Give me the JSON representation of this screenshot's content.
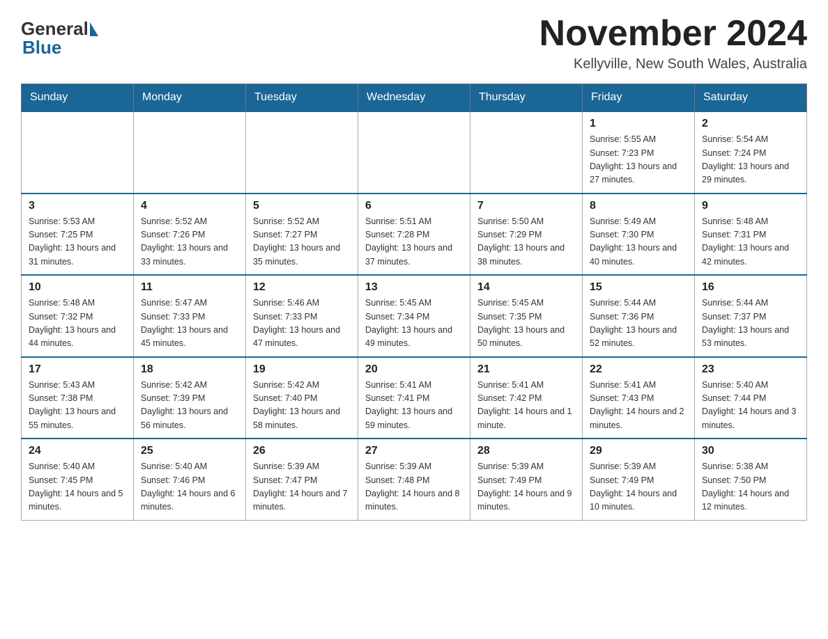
{
  "header": {
    "logo_general": "General",
    "logo_blue": "Blue",
    "month_title": "November 2024",
    "location": "Kellyville, New South Wales, Australia"
  },
  "days_of_week": [
    "Sunday",
    "Monday",
    "Tuesday",
    "Wednesday",
    "Thursday",
    "Friday",
    "Saturday"
  ],
  "weeks": [
    {
      "days": [
        {
          "num": "",
          "info": ""
        },
        {
          "num": "",
          "info": ""
        },
        {
          "num": "",
          "info": ""
        },
        {
          "num": "",
          "info": ""
        },
        {
          "num": "",
          "info": ""
        },
        {
          "num": "1",
          "info": "Sunrise: 5:55 AM\nSunset: 7:23 PM\nDaylight: 13 hours\nand 27 minutes."
        },
        {
          "num": "2",
          "info": "Sunrise: 5:54 AM\nSunset: 7:24 PM\nDaylight: 13 hours\nand 29 minutes."
        }
      ]
    },
    {
      "days": [
        {
          "num": "3",
          "info": "Sunrise: 5:53 AM\nSunset: 7:25 PM\nDaylight: 13 hours\nand 31 minutes."
        },
        {
          "num": "4",
          "info": "Sunrise: 5:52 AM\nSunset: 7:26 PM\nDaylight: 13 hours\nand 33 minutes."
        },
        {
          "num": "5",
          "info": "Sunrise: 5:52 AM\nSunset: 7:27 PM\nDaylight: 13 hours\nand 35 minutes."
        },
        {
          "num": "6",
          "info": "Sunrise: 5:51 AM\nSunset: 7:28 PM\nDaylight: 13 hours\nand 37 minutes."
        },
        {
          "num": "7",
          "info": "Sunrise: 5:50 AM\nSunset: 7:29 PM\nDaylight: 13 hours\nand 38 minutes."
        },
        {
          "num": "8",
          "info": "Sunrise: 5:49 AM\nSunset: 7:30 PM\nDaylight: 13 hours\nand 40 minutes."
        },
        {
          "num": "9",
          "info": "Sunrise: 5:48 AM\nSunset: 7:31 PM\nDaylight: 13 hours\nand 42 minutes."
        }
      ]
    },
    {
      "days": [
        {
          "num": "10",
          "info": "Sunrise: 5:48 AM\nSunset: 7:32 PM\nDaylight: 13 hours\nand 44 minutes."
        },
        {
          "num": "11",
          "info": "Sunrise: 5:47 AM\nSunset: 7:33 PM\nDaylight: 13 hours\nand 45 minutes."
        },
        {
          "num": "12",
          "info": "Sunrise: 5:46 AM\nSunset: 7:33 PM\nDaylight: 13 hours\nand 47 minutes."
        },
        {
          "num": "13",
          "info": "Sunrise: 5:45 AM\nSunset: 7:34 PM\nDaylight: 13 hours\nand 49 minutes."
        },
        {
          "num": "14",
          "info": "Sunrise: 5:45 AM\nSunset: 7:35 PM\nDaylight: 13 hours\nand 50 minutes."
        },
        {
          "num": "15",
          "info": "Sunrise: 5:44 AM\nSunset: 7:36 PM\nDaylight: 13 hours\nand 52 minutes."
        },
        {
          "num": "16",
          "info": "Sunrise: 5:44 AM\nSunset: 7:37 PM\nDaylight: 13 hours\nand 53 minutes."
        }
      ]
    },
    {
      "days": [
        {
          "num": "17",
          "info": "Sunrise: 5:43 AM\nSunset: 7:38 PM\nDaylight: 13 hours\nand 55 minutes."
        },
        {
          "num": "18",
          "info": "Sunrise: 5:42 AM\nSunset: 7:39 PM\nDaylight: 13 hours\nand 56 minutes."
        },
        {
          "num": "19",
          "info": "Sunrise: 5:42 AM\nSunset: 7:40 PM\nDaylight: 13 hours\nand 58 minutes."
        },
        {
          "num": "20",
          "info": "Sunrise: 5:41 AM\nSunset: 7:41 PM\nDaylight: 13 hours\nand 59 minutes."
        },
        {
          "num": "21",
          "info": "Sunrise: 5:41 AM\nSunset: 7:42 PM\nDaylight: 14 hours\nand 1 minute."
        },
        {
          "num": "22",
          "info": "Sunrise: 5:41 AM\nSunset: 7:43 PM\nDaylight: 14 hours\nand 2 minutes."
        },
        {
          "num": "23",
          "info": "Sunrise: 5:40 AM\nSunset: 7:44 PM\nDaylight: 14 hours\nand 3 minutes."
        }
      ]
    },
    {
      "days": [
        {
          "num": "24",
          "info": "Sunrise: 5:40 AM\nSunset: 7:45 PM\nDaylight: 14 hours\nand 5 minutes."
        },
        {
          "num": "25",
          "info": "Sunrise: 5:40 AM\nSunset: 7:46 PM\nDaylight: 14 hours\nand 6 minutes."
        },
        {
          "num": "26",
          "info": "Sunrise: 5:39 AM\nSunset: 7:47 PM\nDaylight: 14 hours\nand 7 minutes."
        },
        {
          "num": "27",
          "info": "Sunrise: 5:39 AM\nSunset: 7:48 PM\nDaylight: 14 hours\nand 8 minutes."
        },
        {
          "num": "28",
          "info": "Sunrise: 5:39 AM\nSunset: 7:49 PM\nDaylight: 14 hours\nand 9 minutes."
        },
        {
          "num": "29",
          "info": "Sunrise: 5:39 AM\nSunset: 7:49 PM\nDaylight: 14 hours\nand 10 minutes."
        },
        {
          "num": "30",
          "info": "Sunrise: 5:38 AM\nSunset: 7:50 PM\nDaylight: 14 hours\nand 12 minutes."
        }
      ]
    }
  ]
}
